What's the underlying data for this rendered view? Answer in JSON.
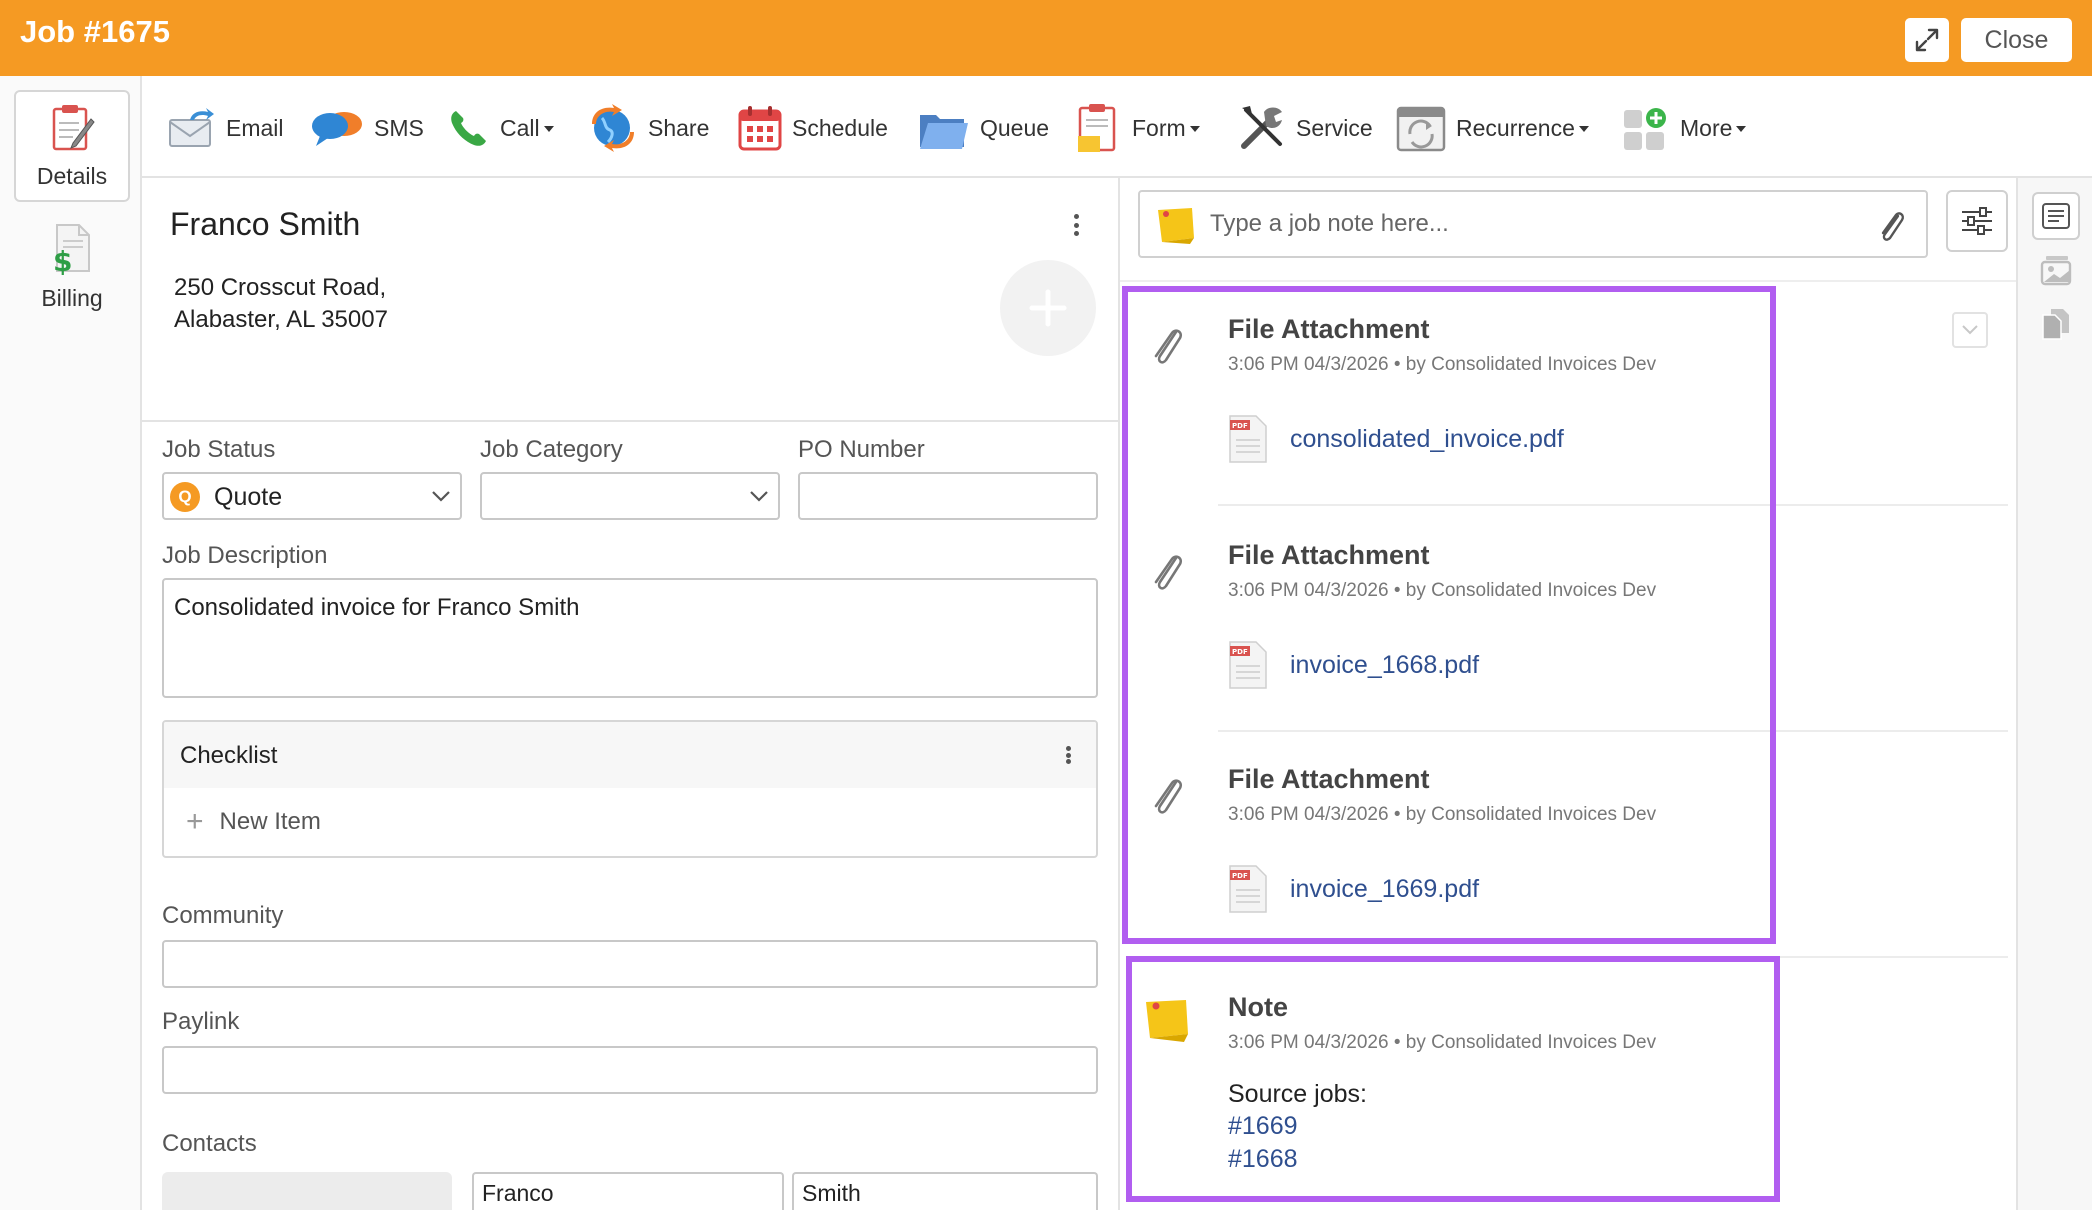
{
  "window": {
    "title": "Job #1675",
    "close_label": "Close",
    "accent_color": "#f59a23"
  },
  "leftnav": {
    "items": [
      {
        "label": "Details",
        "icon": "clipboard-icon",
        "active": true
      },
      {
        "label": "Billing",
        "icon": "billing-icon",
        "active": false
      }
    ]
  },
  "toolbar": {
    "items": [
      {
        "label": "Email",
        "icon": "email-icon",
        "dropdown": false
      },
      {
        "label": "SMS",
        "icon": "sms-icon",
        "dropdown": false
      },
      {
        "label": "Call",
        "icon": "phone-icon",
        "dropdown": true
      },
      {
        "label": "Share",
        "icon": "share-icon",
        "dropdown": false
      },
      {
        "label": "Schedule",
        "icon": "calendar-icon",
        "dropdown": false
      },
      {
        "label": "Queue",
        "icon": "folder-icon",
        "dropdown": false
      },
      {
        "label": "Form",
        "icon": "form-icon",
        "dropdown": true
      },
      {
        "label": "Service",
        "icon": "tools-icon",
        "dropdown": false
      },
      {
        "label": "Recurrence",
        "icon": "recurrence-icon",
        "dropdown": true
      },
      {
        "label": "More",
        "icon": "more-apps-icon",
        "dropdown": true
      }
    ]
  },
  "customer": {
    "name": "Franco Smith",
    "address_line1": "250 Crosscut Road,",
    "address_line2": "Alabaster, AL 35007"
  },
  "form": {
    "job_status": {
      "label": "Job Status",
      "value": "Quote",
      "badge": "Q"
    },
    "job_category": {
      "label": "Job Category",
      "value": ""
    },
    "po_number": {
      "label": "PO Number",
      "value": ""
    },
    "job_description": {
      "label": "Job Description",
      "value": "Consolidated invoice for Franco Smith"
    },
    "checklist": {
      "title": "Checklist",
      "new_item": "New Item"
    },
    "community": {
      "label": "Community",
      "value": ""
    },
    "paylink": {
      "label": "Paylink",
      "value": ""
    },
    "contacts": {
      "label": "Contacts",
      "first_name": "Franco",
      "last_name": "Smith"
    }
  },
  "notes": {
    "placeholder": "Type a job note here...",
    "entries": [
      {
        "type": "File Attachment",
        "time": "3:06 PM 04/3/2026",
        "author": "by Consolidated Invoices Dev",
        "file": "consolidated_invoice.pdf"
      },
      {
        "type": "File Attachment",
        "time": "3:06 PM 04/3/2026",
        "author": "by Consolidated Invoices Dev",
        "file": "invoice_1668.pdf"
      },
      {
        "type": "File Attachment",
        "time": "3:06 PM 04/3/2026",
        "author": "by Consolidated Invoices Dev",
        "file": "invoice_1669.pdf"
      }
    ],
    "note": {
      "type": "Note",
      "time": "3:06 PM 04/3/2026",
      "author": "by Consolidated Invoices Dev",
      "body_label": "Source jobs:",
      "links": [
        "#1669",
        "#1668"
      ]
    },
    "meta_separator": "•",
    "highlight_color": "#b15ef0"
  }
}
